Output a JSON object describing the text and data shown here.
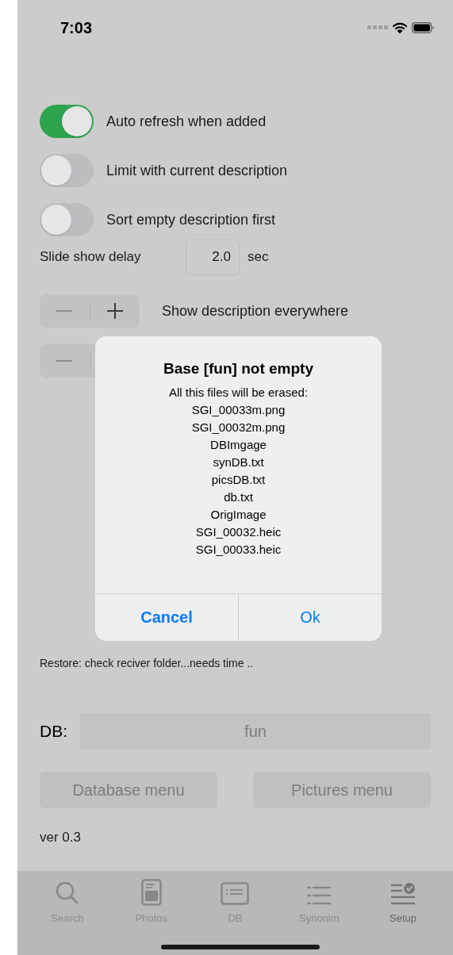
{
  "status_bar": {
    "time": "7:03"
  },
  "toggles": [
    {
      "label": "Auto refresh when added",
      "on": true
    },
    {
      "label": "Limit with current description",
      "on": false
    },
    {
      "label": "Sort empty description first",
      "on": false
    }
  ],
  "slide_show": {
    "label": "Slide show delay",
    "value": "2.0",
    "unit": "sec"
  },
  "steppers": [
    {
      "kind": "labeled",
      "label": "Show description everywhere"
    },
    {
      "kind": "plain"
    }
  ],
  "status_message": "Restore: check reciver folder...needs time ..",
  "db": {
    "label": "DB:",
    "value": "fun"
  },
  "buttons": [
    "Database menu",
    "Pictures menu"
  ],
  "version": "ver 0.3",
  "tab_bar": [
    {
      "label": "Search",
      "selected": false
    },
    {
      "label": "Photos",
      "selected": false
    },
    {
      "label": "DB",
      "selected": false
    },
    {
      "label": "Synonim",
      "selected": false
    },
    {
      "label": "Setup",
      "selected": true
    }
  ],
  "alert": {
    "title": "Base [fun] not empty",
    "message_lines": [
      "All this files will be erased:",
      "SGI_00033m.png",
      "SGI_00032m.png",
      "DBImgage",
      "synDB.txt",
      "picsDB.txt",
      "db.txt",
      "OrigImage",
      "SGI_00032.heic",
      "SGI_00033.heic"
    ],
    "actions": [
      {
        "label": "Cancel",
        "kind": "cancel"
      },
      {
        "label": "Ok",
        "kind": "default"
      }
    ]
  }
}
